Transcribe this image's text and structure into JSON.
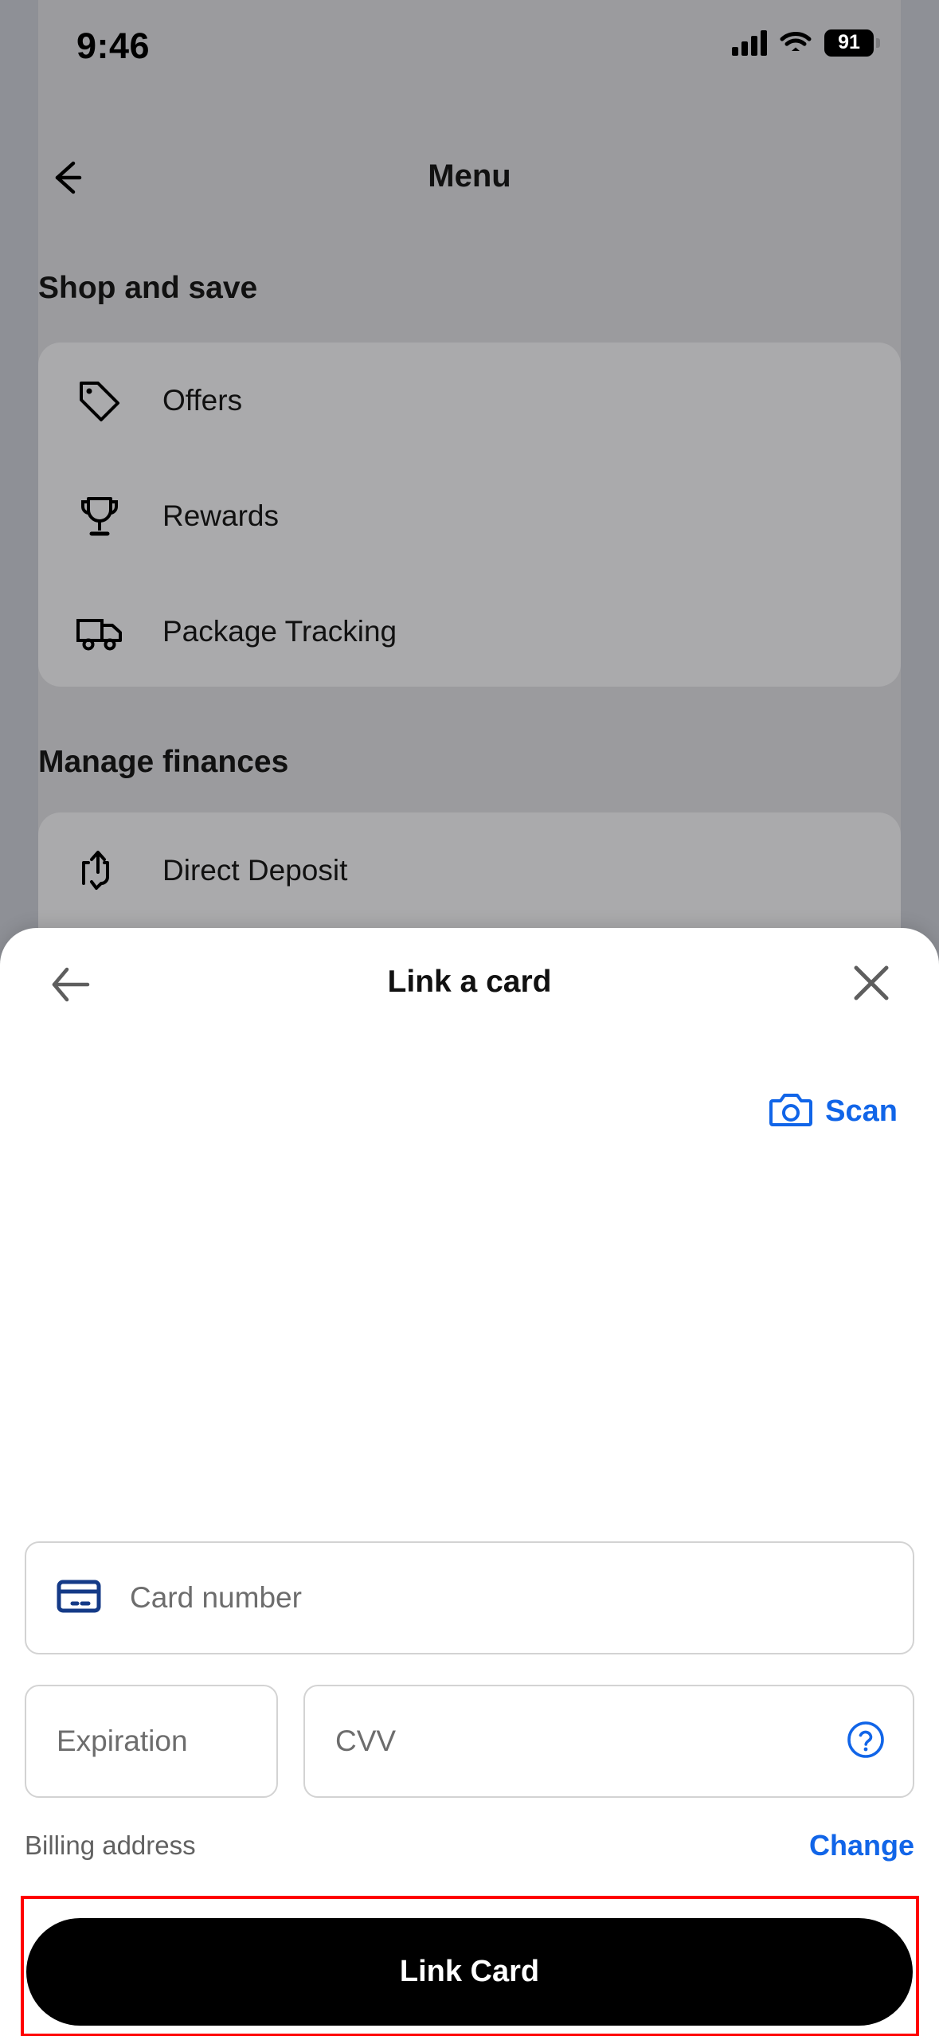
{
  "status_bar": {
    "time": "9:46",
    "signal_icon": "cellular-signal-icon",
    "wifi_icon": "wifi-icon",
    "battery_level": "91"
  },
  "background_screen": {
    "back_icon": "back-arrow-icon",
    "title": "Menu",
    "sections": [
      {
        "heading": "Shop and save",
        "items": [
          {
            "label": "Offers",
            "icon": "tag-icon"
          },
          {
            "label": "Rewards",
            "icon": "trophy-icon"
          },
          {
            "label": "Package Tracking",
            "icon": "delivery-truck-icon"
          }
        ]
      },
      {
        "heading": "Manage finances",
        "items": [
          {
            "label": "Direct Deposit",
            "icon": "hand-up-arrow-icon"
          }
        ]
      }
    ]
  },
  "sheet": {
    "back_icon": "back-arrow-icon",
    "title": "Link a card",
    "close_icon": "close-x-icon",
    "scan": {
      "icon": "camera-icon",
      "label": "Scan",
      "color": "#1165e8"
    },
    "fields": {
      "card_number": {
        "placeholder": "Card number",
        "icon": "credit-card-icon",
        "icon_color": "#143a87",
        "value": ""
      },
      "expiration": {
        "placeholder": "Expiration",
        "value": ""
      },
      "cvv": {
        "placeholder": "CVV",
        "help_icon": "help-circle-icon",
        "help_icon_color": "#1165e8",
        "value": ""
      }
    },
    "billing": {
      "label": "Billing address",
      "change_label": "Change"
    },
    "primary_action": {
      "label": "Link Card",
      "background": "#000000",
      "text_color": "#ffffff"
    },
    "highlight_color": "#ff0000"
  }
}
